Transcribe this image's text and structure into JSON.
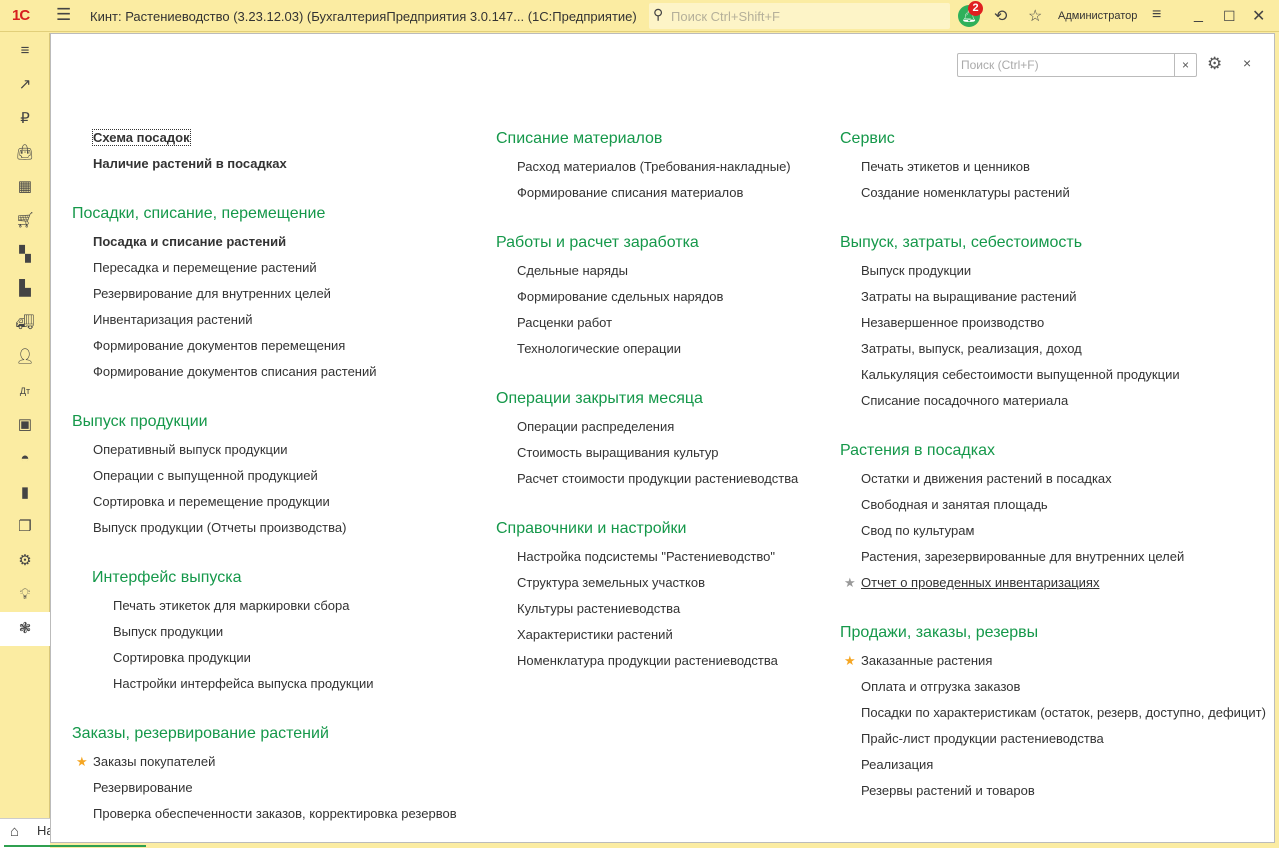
{
  "titlebar": {
    "logo": "1С",
    "title": "Кинт: Растениеводство (3.23.12.03) (БухгалтерияПредприятия 3.0.147...  (1С:Предприятие)",
    "search_placeholder": "Поиск Ctrl+Shift+F",
    "notifications": "2",
    "user": "Администратор"
  },
  "sidebar": {
    "items": [
      "menu",
      "trending",
      "ruble",
      "bag",
      "calculator",
      "cart",
      "grid",
      "factory",
      "truck",
      "person",
      "dt-kt",
      "presentation",
      "gauge",
      "bar-chart",
      "stack",
      "gear",
      "bulb",
      "plant"
    ],
    "active": 17
  },
  "panel": {
    "search_placeholder": "Поиск (Ctrl+F)",
    "clear": "×",
    "close": "×"
  },
  "bottom": {
    "home_tab": "На"
  },
  "colors": {
    "accent": "#15984a",
    "bar": "#fbeca2",
    "star_fav": "#f5a623",
    "star_off": "#999999"
  },
  "columns": [
    {
      "blocks": [
        {
          "t": "item",
          "label": "Схема посадок",
          "bold": true,
          "focus": true
        },
        {
          "t": "item",
          "label": "Наличие растений в посадках",
          "bold": true
        },
        {
          "t": "head",
          "label": "Посадки, списание, перемещение"
        },
        {
          "t": "item",
          "label": "Посадка и списание растений",
          "bold": true
        },
        {
          "t": "item",
          "label": "Пересадка и перемещение растений"
        },
        {
          "t": "item",
          "label": "Резервирование для внутренних целей"
        },
        {
          "t": "item",
          "label": "Инвентаризация растений"
        },
        {
          "t": "item",
          "label": "Формирование документов перемещения"
        },
        {
          "t": "item",
          "label": "Формирование документов списания растений"
        },
        {
          "t": "head",
          "label": "Выпуск продукции"
        },
        {
          "t": "item",
          "label": "Оперативный выпуск продукции"
        },
        {
          "t": "item",
          "label": "Операции с выпущенной продукцией"
        },
        {
          "t": "item",
          "label": "Сортировка и перемещение продукции"
        },
        {
          "t": "item",
          "label": "Выпуск продукции (Отчеты производства)"
        },
        {
          "t": "head",
          "label": "Интерфейс выпуска",
          "sub": true
        },
        {
          "t": "item",
          "label": "Печать этикеток для маркировки сбора",
          "sub": true
        },
        {
          "t": "item",
          "label": "Выпуск продукции",
          "sub": true
        },
        {
          "t": "item",
          "label": "Сортировка продукции",
          "sub": true
        },
        {
          "t": "item",
          "label": "Настройки интерфейса выпуска продукции",
          "sub": true
        },
        {
          "t": "head",
          "label": "Заказы, резервирование растений"
        },
        {
          "t": "item",
          "label": "Заказы покупателей",
          "star": "fav"
        },
        {
          "t": "item",
          "label": "Резервирование"
        },
        {
          "t": "item",
          "label": "Проверка обеспеченности заказов, корректировка резервов"
        }
      ]
    },
    {
      "blocks": [
        {
          "t": "head",
          "label": "Списание материалов"
        },
        {
          "t": "item",
          "label": "Расход материалов (Требования-накладные)"
        },
        {
          "t": "item",
          "label": "Формирование списания материалов"
        },
        {
          "t": "head",
          "label": "Работы и расчет заработка"
        },
        {
          "t": "item",
          "label": "Сдельные наряды"
        },
        {
          "t": "item",
          "label": "Формирование сдельных нарядов"
        },
        {
          "t": "item",
          "label": "Расценки работ"
        },
        {
          "t": "item",
          "label": "Технологические операции"
        },
        {
          "t": "head",
          "label": "Операции закрытия месяца"
        },
        {
          "t": "item",
          "label": "Операции распределения"
        },
        {
          "t": "item",
          "label": "Стоимость выращивания культур"
        },
        {
          "t": "item",
          "label": "Расчет стоимости продукции растениеводства"
        },
        {
          "t": "head",
          "label": "Справочники и настройки"
        },
        {
          "t": "item",
          "label": "Настройка подсистемы \"Растениеводство\""
        },
        {
          "t": "item",
          "label": "Структура земельных участков"
        },
        {
          "t": "item",
          "label": "Культуры растениеводства"
        },
        {
          "t": "item",
          "label": "Характеристики растений"
        },
        {
          "t": "item",
          "label": "Номенклатура продукции растениеводства"
        }
      ]
    },
    {
      "blocks": [
        {
          "t": "head",
          "label": "Сервис"
        },
        {
          "t": "item",
          "label": "Печать этикетов и ценников"
        },
        {
          "t": "item",
          "label": "Создание номенклатуры растений"
        },
        {
          "t": "head",
          "label": "Выпуск, затраты, себестоимость"
        },
        {
          "t": "item",
          "label": "Выпуск продукции"
        },
        {
          "t": "item",
          "label": "Затраты на выращивание растений"
        },
        {
          "t": "item",
          "label": "Незавершенное производство"
        },
        {
          "t": "item",
          "label": "Затраты, выпуск, реализация, доход"
        },
        {
          "t": "item",
          "label": "Калькуляция себестоимости выпущенной продукции"
        },
        {
          "t": "item",
          "label": "Списание посадочного материала"
        },
        {
          "t": "head",
          "label": "Растения в посадках"
        },
        {
          "t": "item",
          "label": "Остатки и движения растений в посадках"
        },
        {
          "t": "item",
          "label": "Свободная и занятая площадь"
        },
        {
          "t": "item",
          "label": "Свод по культурам"
        },
        {
          "t": "item",
          "label": "Растения, зарезервированные для внутренних целей"
        },
        {
          "t": "item",
          "label": "Отчет о проведенных инвентаризациях",
          "star": "off",
          "underline": true
        },
        {
          "t": "head",
          "label": "Продажи, заказы, резервы"
        },
        {
          "t": "item",
          "label": "Заказанные растения",
          "star": "fav"
        },
        {
          "t": "item",
          "label": "Оплата и отгрузка заказов"
        },
        {
          "t": "item",
          "label": "Посадки по характеристикам (остаток, резерв, доступно, дефицит)"
        },
        {
          "t": "item",
          "label": "Прайс-лист продукции растениеводства"
        },
        {
          "t": "item",
          "label": "Реализация"
        },
        {
          "t": "item",
          "label": "Резервы растений и товаров"
        }
      ]
    }
  ]
}
